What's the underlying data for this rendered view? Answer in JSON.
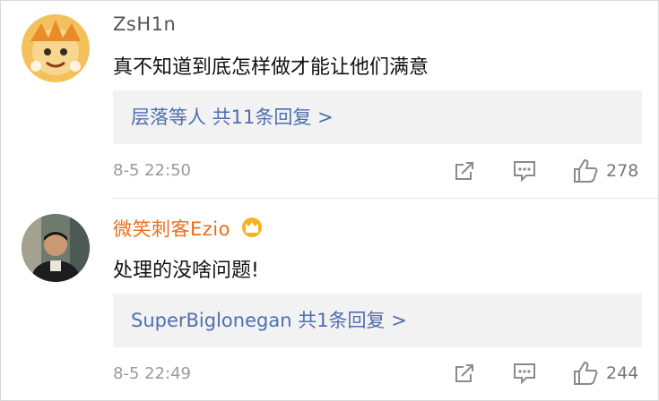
{
  "comments": [
    {
      "username": "ZsH1n",
      "text": "真不知道到底怎样做才能让他们满意",
      "reply_summary": "层落等人 共11条回复 >",
      "time": "8-5 22:50",
      "likes": "278"
    },
    {
      "username": "微笑刺客Ezio",
      "text": "处理的没啥问题!",
      "reply_summary": "SuperBiglonegan 共1条回复 >",
      "time": "8-5 22:49",
      "likes": "244"
    }
  ],
  "colors": {
    "username_normal": "#555555",
    "username_vip": "#e86e1b",
    "reply_link": "#4e6fb0",
    "reply_box_bg": "#f2f2f2",
    "meta": "#9a9a9a",
    "crown": "#f6b31d"
  },
  "icons": [
    "avatar-cartoon",
    "avatar-photo",
    "crown-icon",
    "share-icon",
    "comment-icon",
    "thumbs-up-icon"
  ]
}
